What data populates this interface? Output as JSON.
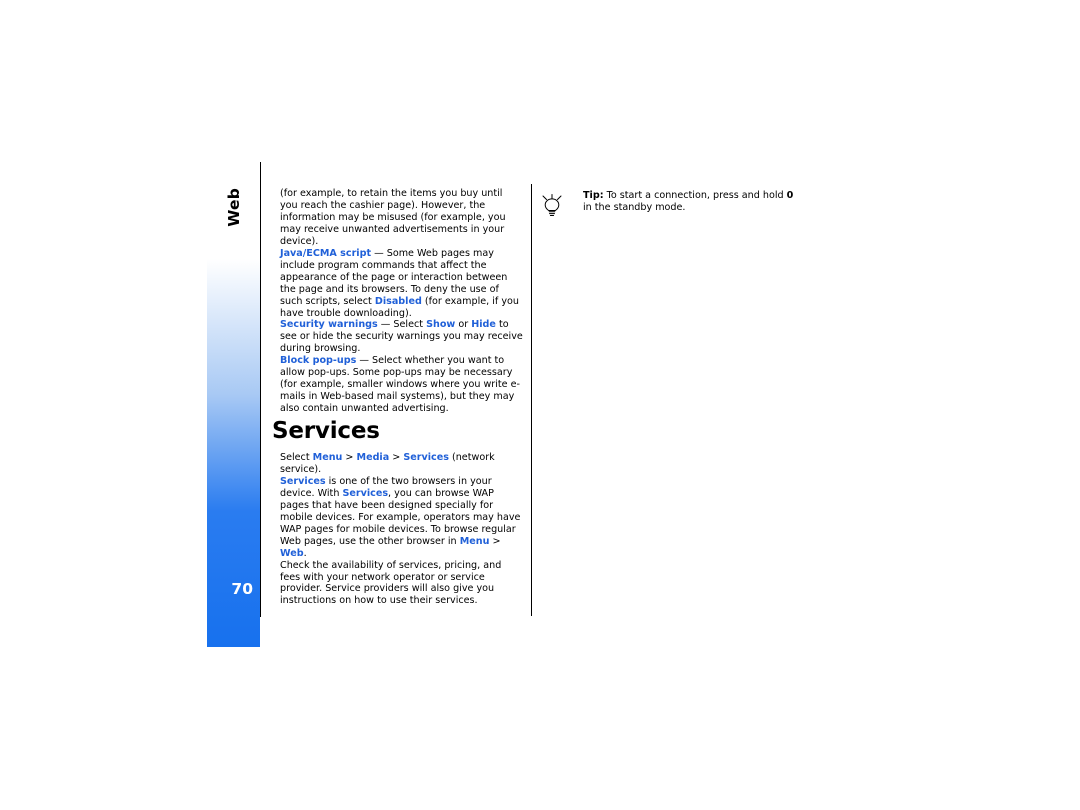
{
  "document": {
    "chapter_label": "Web",
    "page_number": "70",
    "heading": "Services"
  },
  "left_column": {
    "paragraphs": [
      {
        "id": "p1",
        "runs": [
          {
            "text": "(for example, to retain the items you buy until you reach the cashier page). However, the information may be misused (for example, you may receive unwanted advertisements in your device).",
            "style": "normal"
          }
        ]
      },
      {
        "id": "p2",
        "runs": [
          {
            "text": "Java/ECMA script",
            "style": "blue-bold"
          },
          {
            "text": " — Some Web pages may include program commands that affect the appearance of the page or interaction between the page and its browsers. To deny the use of such scripts, select ",
            "style": "normal"
          },
          {
            "text": "Disabled",
            "style": "blue-bold"
          },
          {
            "text": " (for example, if you have trouble downloading).",
            "style": "normal"
          }
        ]
      },
      {
        "id": "p3",
        "runs": [
          {
            "text": "Security warnings",
            "style": "blue-bold"
          },
          {
            "text": " — Select ",
            "style": "normal"
          },
          {
            "text": "Show",
            "style": "blue-bold"
          },
          {
            "text": " or ",
            "style": "normal"
          },
          {
            "text": "Hide",
            "style": "blue-bold"
          },
          {
            "text": " to see or hide the security warnings you may receive during browsing.",
            "style": "normal"
          }
        ]
      },
      {
        "id": "p4",
        "runs": [
          {
            "text": "Block pop-ups",
            "style": "blue-bold"
          },
          {
            "text": " — Select whether you want to allow pop-ups. Some pop-ups may be necessary (for example, smaller windows where you write e-mails in Web-based mail systems), but they may also contain unwanted advertising.",
            "style": "normal"
          }
        ]
      }
    ],
    "after_heading": [
      {
        "id": "s1",
        "runs": [
          {
            "text": "Select ",
            "style": "normal"
          },
          {
            "text": "Menu",
            "style": "blue-bold"
          },
          {
            "text": " > ",
            "style": "gt"
          },
          {
            "text": "Media",
            "style": "blue-bold"
          },
          {
            "text": " > ",
            "style": "gt"
          },
          {
            "text": "Services",
            "style": "blue-bold"
          },
          {
            "text": " (network service).",
            "style": "normal"
          }
        ]
      },
      {
        "id": "s2",
        "runs": [
          {
            "text": "Services",
            "style": "blue-bold"
          },
          {
            "text": " is one of the two browsers in your device. With ",
            "style": "normal"
          },
          {
            "text": "Services",
            "style": "blue-bold"
          },
          {
            "text": ", you can browse WAP pages that have been designed specially for mobile devices. For example, operators may have WAP pages for mobile devices. To browse regular Web pages, use the other browser in ",
            "style": "normal"
          },
          {
            "text": "Menu",
            "style": "blue-bold"
          },
          {
            "text": " > ",
            "style": "gt"
          },
          {
            "text": "Web",
            "style": "blue-bold"
          },
          {
            "text": ".",
            "style": "normal"
          }
        ]
      },
      {
        "id": "s3",
        "runs": [
          {
            "text": "Check the availability of services, pricing, and fees with your network operator or service provider. Service providers will also give you instructions on how to use their services.",
            "style": "normal"
          }
        ]
      }
    ]
  },
  "right_column": {
    "tip": {
      "icon_name": "lightbulb-tip-icon",
      "runs": [
        {
          "text": "Tip:",
          "style": "bold"
        },
        {
          "text": " To start a connection, press and hold ",
          "style": "normal"
        },
        {
          "text": "0",
          "style": "bold"
        },
        {
          "text": " in the standby mode.",
          "style": "normal"
        }
      ]
    }
  },
  "colors": {
    "accent_blue": "#2060d8",
    "tab_blue": "#1771ee",
    "text": "#000000"
  }
}
